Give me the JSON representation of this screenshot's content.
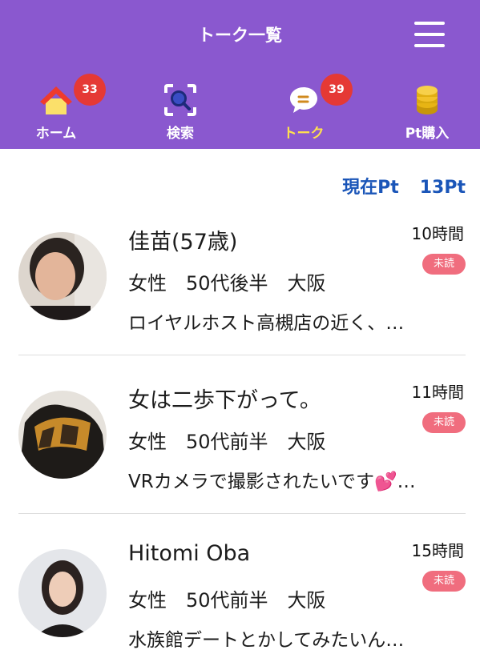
{
  "header": {
    "title": "トーク一覧",
    "menu_icon": "hamburger-menu-icon"
  },
  "nav": [
    {
      "label": "ホーム",
      "icon": "home-icon",
      "badge": "33",
      "active": false
    },
    {
      "label": "検索",
      "icon": "search-icon",
      "badge": "",
      "active": false
    },
    {
      "label": "トーク",
      "icon": "chat-bubble-icon",
      "badge": "39",
      "active": true
    },
    {
      "label": "Pt購入",
      "icon": "coin-stack-icon",
      "badge": "",
      "active": false
    }
  ],
  "points": {
    "label": "現在Pt",
    "value": "13Pt"
  },
  "conversations": [
    {
      "name": "佳苗(57歳)",
      "meta": "女性　50代後半　大阪",
      "message": "ロイヤルホスト高槻店の近く、…",
      "time": "10時間前",
      "unread_label": "未読"
    },
    {
      "name": "女は二歩下がって。",
      "meta": "女性　50代前半　大阪",
      "message": "VRカメラで撮影されたいです💕…",
      "time": "11時間前",
      "unread_label": "未読"
    },
    {
      "name": "Hitomi Oba",
      "meta": "女性　50代前半　大阪",
      "message": "水族館デートとかしてみたいん…",
      "time": "15時間前",
      "unread_label": "未読"
    }
  ],
  "colors": {
    "header_bg": "#8a58cf",
    "active_tab": "#ffe14d",
    "badge": "#e53935",
    "points_text": "#1a55b8",
    "unread_badge": "#f06d7e"
  }
}
